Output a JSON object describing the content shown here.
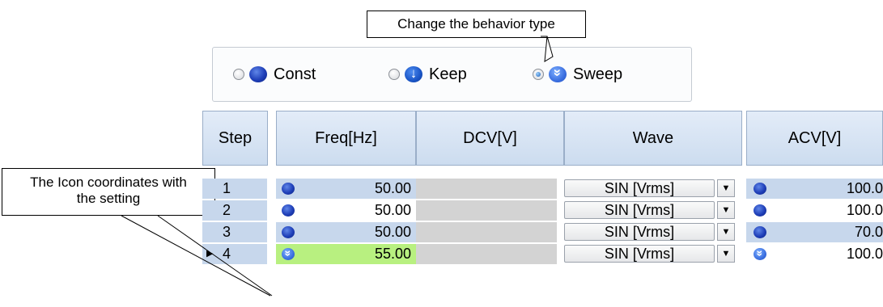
{
  "callouts": {
    "behavior": "Change the behavior type",
    "icon_line1": "The Icon coordinates with",
    "icon_line2": "the setting"
  },
  "behavior_options": [
    {
      "label": "Const",
      "icon": "const-circle-icon",
      "selected": false
    },
    {
      "label": "Keep",
      "icon": "keep-arrow-icon",
      "selected": false
    },
    {
      "label": "Sweep",
      "icon": "sweep-chevron-icon",
      "selected": true
    }
  ],
  "table": {
    "headers": [
      "Step",
      "Freq[Hz]",
      "DCV[V]",
      "Wave",
      "ACV[V]"
    ],
    "rows": [
      {
        "step": "1",
        "freq": "50.00",
        "freq_icon": "const",
        "wave": "SIN [Vrms]",
        "acv": "100.0",
        "acv_icon": "const",
        "current": false
      },
      {
        "step": "2",
        "freq": "50.00",
        "freq_icon": "const",
        "wave": "SIN [Vrms]",
        "acv": "100.0",
        "acv_icon": "const",
        "current": false
      },
      {
        "step": "3",
        "freq": "50.00",
        "freq_icon": "const",
        "wave": "SIN [Vrms]",
        "acv": "70.0",
        "acv_icon": "const",
        "current": false
      },
      {
        "step": "4",
        "freq": "55.00",
        "freq_icon": "sweep",
        "wave": "SIN [Vrms]",
        "acv": "100.0",
        "acv_icon": "sweep",
        "current": true
      }
    ]
  },
  "colors": {
    "row_alt": "#c7d7ec",
    "row_plain": "#ffffff",
    "selected_cell": "#b8f080",
    "dcv_disabled": "#d3d3d3"
  }
}
